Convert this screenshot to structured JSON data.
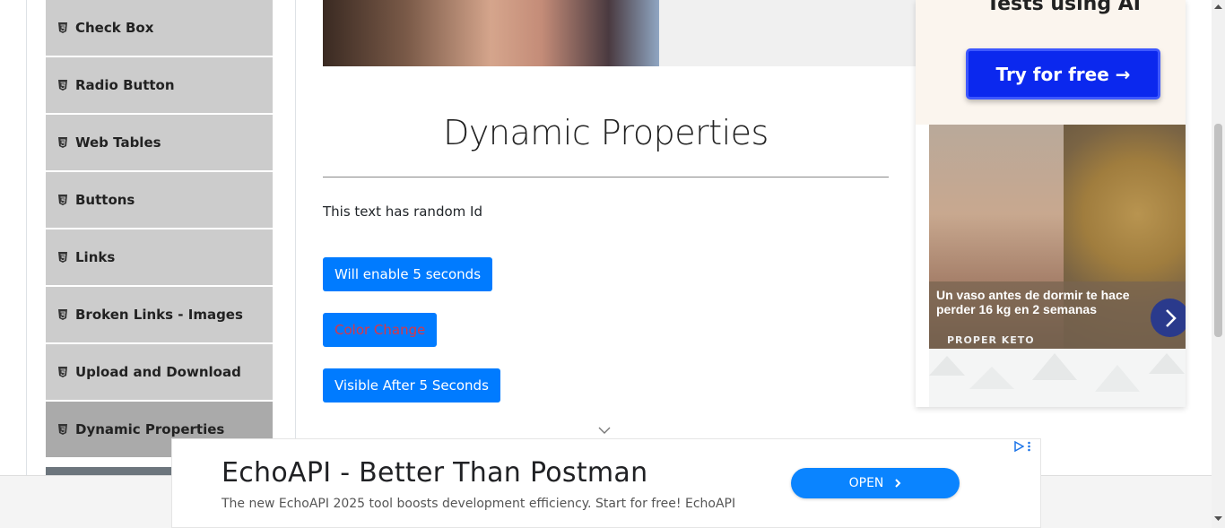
{
  "sidebar": {
    "items": [
      {
        "label": "Check Box",
        "active": false
      },
      {
        "label": "Radio Button",
        "active": false
      },
      {
        "label": "Web Tables",
        "active": false
      },
      {
        "label": "Buttons",
        "active": false
      },
      {
        "label": "Links",
        "active": false
      },
      {
        "label": "Broken Links - Images",
        "active": false
      },
      {
        "label": "Upload and Download",
        "active": false
      },
      {
        "label": "Dynamic Properties",
        "active": true
      }
    ]
  },
  "main": {
    "title": "Dynamic Properties",
    "random_id_text": "This text has random Id",
    "buttons": {
      "enable_after": "Will enable 5 seconds",
      "color_change": "Color Change",
      "visible_after": "Visible After 5 Seconds"
    }
  },
  "side_ad": {
    "heading": "Tests using AI",
    "cta": "Try for free →",
    "caption": "Un vaso antes de dormir te hace perder 16 kg en 2 semanas",
    "brand": "PROPER KETO"
  },
  "bottom_ad": {
    "title": "EchoAPI - Better Than Postman",
    "description": "The new EchoAPI 2025 tool boosts development efficiency. Start for free! EchoAPI",
    "cta": "OPEN"
  },
  "colors": {
    "primary_button": "#007bff",
    "sidebar_item": "#cccccc",
    "sidebar_active": "#aaaaaa",
    "color_change_text": "#dc3545",
    "ad_cta": "#0b28ee",
    "open_button": "#0a84ff"
  },
  "icons": {
    "menu_item": "html5-icon",
    "chevron": "chevron-down-icon",
    "ad_next": "chevron-right-icon",
    "adchoices": "adchoices-icon"
  }
}
